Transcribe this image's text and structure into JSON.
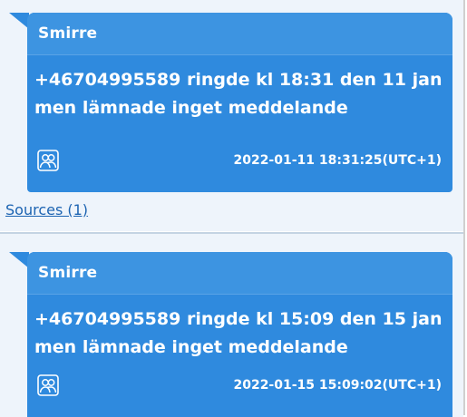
{
  "messages": [
    {
      "sender": "Smirre",
      "text": "+46704995589 ringde kl 18:31 den 11 jan men lämnade inget meddelande",
      "timestamp": "2022-01-11 18:31:25(UTC+1)",
      "icon": "contacts-icon"
    },
    {
      "sender": "Smirre",
      "text": "+46704995589 ringde kl 15:09 den 15 jan men lämnade inget meddelande",
      "timestamp": "2022-01-15 15:09:02(UTC+1)",
      "icon": "contacts-icon"
    }
  ],
  "sources_link": "Sources (1)",
  "colors": {
    "bubble": "#2f8ade",
    "header": "#3d94e1",
    "link": "#1d64b2"
  }
}
